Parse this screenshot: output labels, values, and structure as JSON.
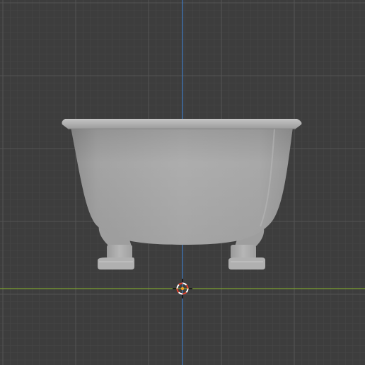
{
  "viewport": {
    "view": "front-orthographic",
    "grid": "on",
    "colors": {
      "background": "#3d3d3d",
      "grid_minor": "#474747",
      "grid_major": "#545454",
      "x_axis": "#7da12f",
      "z_axis": "#3f7bc2",
      "cursor_red": "#e8412b",
      "cursor_white": "#ffffff",
      "cursor_center": "#f0a020",
      "mesh_base": "#a9a9a9"
    },
    "scene_object": {
      "name": "bathtub",
      "feet": 2
    },
    "cursor_icon": "3d-cursor-icon"
  }
}
